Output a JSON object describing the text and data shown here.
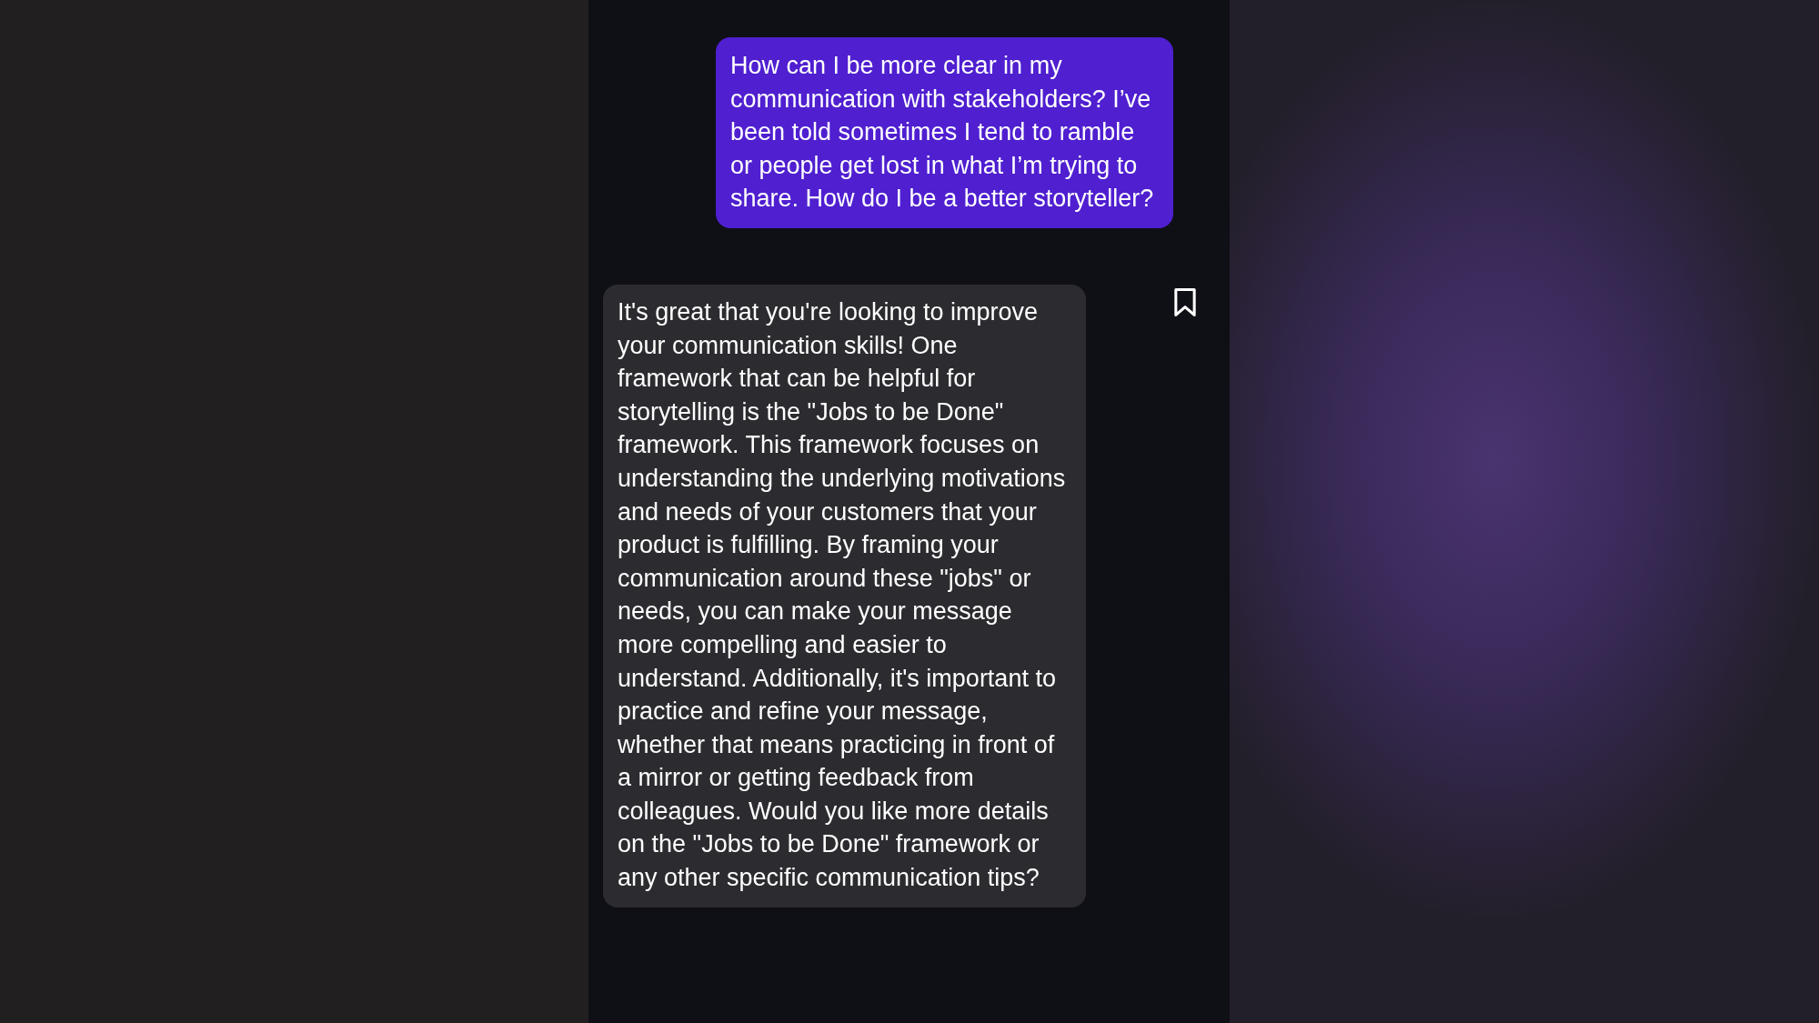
{
  "messages": [
    {
      "kind": "user",
      "text": "How can I be more clear in my communication with stakeholders? I’ve been told sometimes I tend to ramble or people get lost in what I’m trying to share. How do I be a better storyteller?"
    },
    {
      "kind": "assistant",
      "text": "It's great that you're looking to improve your communication skills! One framework that can be helpful for storytelling is the \"Jobs to be Done\" framework. This framework focuses on understanding the underlying motivations and needs of your customers that your product is fulfilling. By framing your communication around these \"jobs\" or needs, you can make your message more compelling and easier to understand. Additionally, it's important to practice and refine your message, whether that means practicing in front of a mirror or getting feedback from colleagues. Would you like more details on the \"Jobs to be Done\" framework or any other specific communication tips?"
    }
  ]
}
